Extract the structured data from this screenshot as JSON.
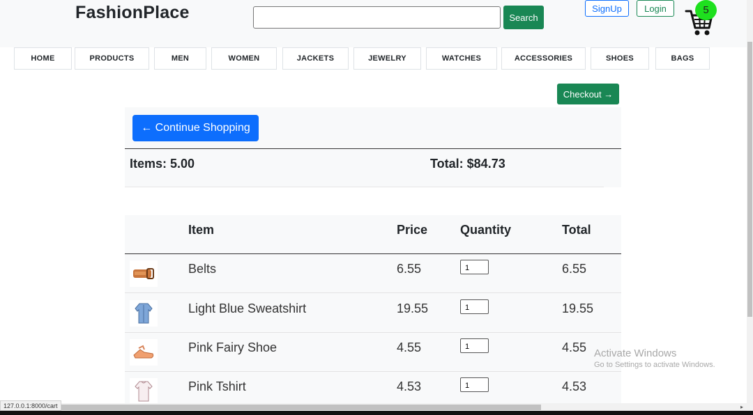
{
  "header": {
    "brand": "FashionPlace",
    "search_placeholder": "",
    "search_label": "Search",
    "signup_label": "SignUp",
    "login_label": "Login",
    "cart_count": "5"
  },
  "nav": {
    "items": [
      "HOME",
      "PRODUCTS",
      "MEN",
      "WOMEN",
      "JACKETS",
      "JEWELRY",
      "WATCHES",
      "ACCESSORIES",
      "SHOES",
      "BAGS"
    ]
  },
  "checkout_label": "Checkout →",
  "summary": {
    "continue_label": "← Continue Shopping",
    "items_text": "Items: 5.00",
    "total_text": "Total: $84.73"
  },
  "table": {
    "headers": {
      "item": "Item",
      "price": "Price",
      "quantity": "Quantity",
      "total": "Total"
    },
    "rows": [
      {
        "name": "Belts",
        "price": "6.55",
        "qty": "1",
        "total": "6.55",
        "thumb": "belt-icon"
      },
      {
        "name": "Light Blue Sweatshirt",
        "price": "19.55",
        "qty": "1",
        "total": "19.55",
        "thumb": "sweatshirt-icon"
      },
      {
        "name": "Pink Fairy Shoe",
        "price": "4.55",
        "qty": "1",
        "total": "4.55",
        "thumb": "shoe-icon"
      },
      {
        "name": "Pink Tshirt",
        "price": "4.53",
        "qty": "1",
        "total": "4.53",
        "thumb": "tshirt-icon"
      }
    ]
  },
  "watermark": {
    "line1": "Activate Windows",
    "line2": "Go to Settings to activate Windows."
  },
  "status_url": "127.0.0.1:8000/cart",
  "colors": {
    "success": "#198754",
    "primary": "#0d6efd",
    "badge": "#1ee01e"
  }
}
